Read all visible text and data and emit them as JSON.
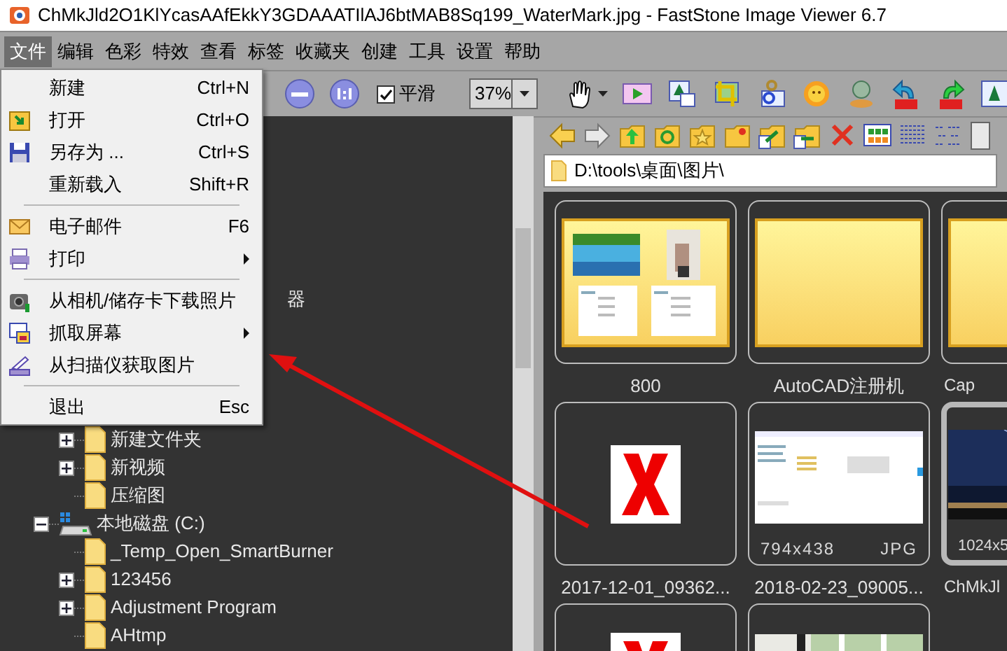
{
  "window": {
    "title": "ChMkJld2O1KlYcasAAfEkkY3GDAAATIlAJ6btMAB8Sq199_WaterMark.jpg  -  FastStone Image Viewer 6.7"
  },
  "menu_bar": [
    {
      "label": "文件",
      "selected": true
    },
    {
      "label": "编辑",
      "selected": false
    },
    {
      "label": "色彩",
      "selected": false
    },
    {
      "label": "特效",
      "selected": false
    },
    {
      "label": "查看",
      "selected": false
    },
    {
      "label": "标签",
      "selected": false
    },
    {
      "label": "收藏夹",
      "selected": false
    },
    {
      "label": "创建",
      "selected": false
    },
    {
      "label": "工具",
      "selected": false
    },
    {
      "label": "设置",
      "selected": false
    },
    {
      "label": "帮助",
      "selected": false
    }
  ],
  "toolbar": {
    "smooth": {
      "label": "平滑",
      "checked": true
    },
    "zoom": {
      "value": "37%"
    }
  },
  "file_menu": [
    {
      "kind": "item",
      "label": "新建",
      "shortcut": "Ctrl+N",
      "submenu": false
    },
    {
      "kind": "item",
      "label": "打开",
      "shortcut": "Ctrl+O",
      "submenu": false
    },
    {
      "kind": "item",
      "label": "另存为 ...",
      "shortcut": "Ctrl+S",
      "submenu": false
    },
    {
      "kind": "item",
      "label": "重新载入",
      "shortcut": "Shift+R",
      "submenu": false
    },
    {
      "kind": "separator"
    },
    {
      "kind": "item",
      "label": "电子邮件",
      "shortcut": "F6",
      "submenu": false
    },
    {
      "kind": "item",
      "label": "打印",
      "submenu": true
    },
    {
      "kind": "separator"
    },
    {
      "kind": "item",
      "label": "从相机/储存卡下载照片",
      "submenu": false
    },
    {
      "kind": "item",
      "label": "抓取屏幕",
      "submenu": true
    },
    {
      "kind": "item",
      "label": "从扫描仪获取图片",
      "submenu": false
    },
    {
      "kind": "separator"
    },
    {
      "kind": "item",
      "label": "退出",
      "shortcut": "Esc",
      "submenu": false
    }
  ],
  "folder_tree": [
    {
      "kind": "hidden",
      "children": [
        {
          "label": "器"
        },
        {
          "kind": "folder",
          "label": "新建文件夹",
          "has_children": true,
          "expanded": false
        },
        {
          "kind": "folder",
          "label": "新视频",
          "has_children": true,
          "expanded": false
        },
        {
          "kind": "folder",
          "label": "压缩图",
          "has_children": false
        }
      ]
    },
    {
      "kind": "drive",
      "label": "本地磁盘 (C:)",
      "has_children": true,
      "expanded": true,
      "children": [
        {
          "kind": "folder",
          "label": "_Temp_Open_SmartBurner",
          "has_children": false
        },
        {
          "kind": "folder",
          "label": "123456",
          "has_children": true,
          "expanded": false
        },
        {
          "kind": "folder",
          "label": "Adjustment Program",
          "has_children": true,
          "expanded": false
        },
        {
          "kind": "folder",
          "label": "AHtmp",
          "has_children": false
        }
      ]
    }
  ],
  "path": "D:\\tools\\桌面\\图片\\",
  "thumbnails": [
    {
      "kind": "folder-preview",
      "label": "800",
      "selected": false
    },
    {
      "kind": "folder",
      "label": "AutoCAD注册机",
      "selected": false
    },
    {
      "kind": "folder",
      "label": "Cap",
      "selected": false
    },
    {
      "kind": "broken",
      "label": "2017-12-01_09362...",
      "selected": false
    },
    {
      "kind": "screenshot",
      "label": "2018-02-23_09005...",
      "dimensions": "794x438",
      "format": "JPG",
      "selected": false
    },
    {
      "kind": "night-photo",
      "label": "ChMkJl",
      "dimensions": "1024x5",
      "selected": true
    },
    {
      "kind": "broken",
      "selected": false
    },
    {
      "kind": "room-photo",
      "selected": false
    }
  ]
}
